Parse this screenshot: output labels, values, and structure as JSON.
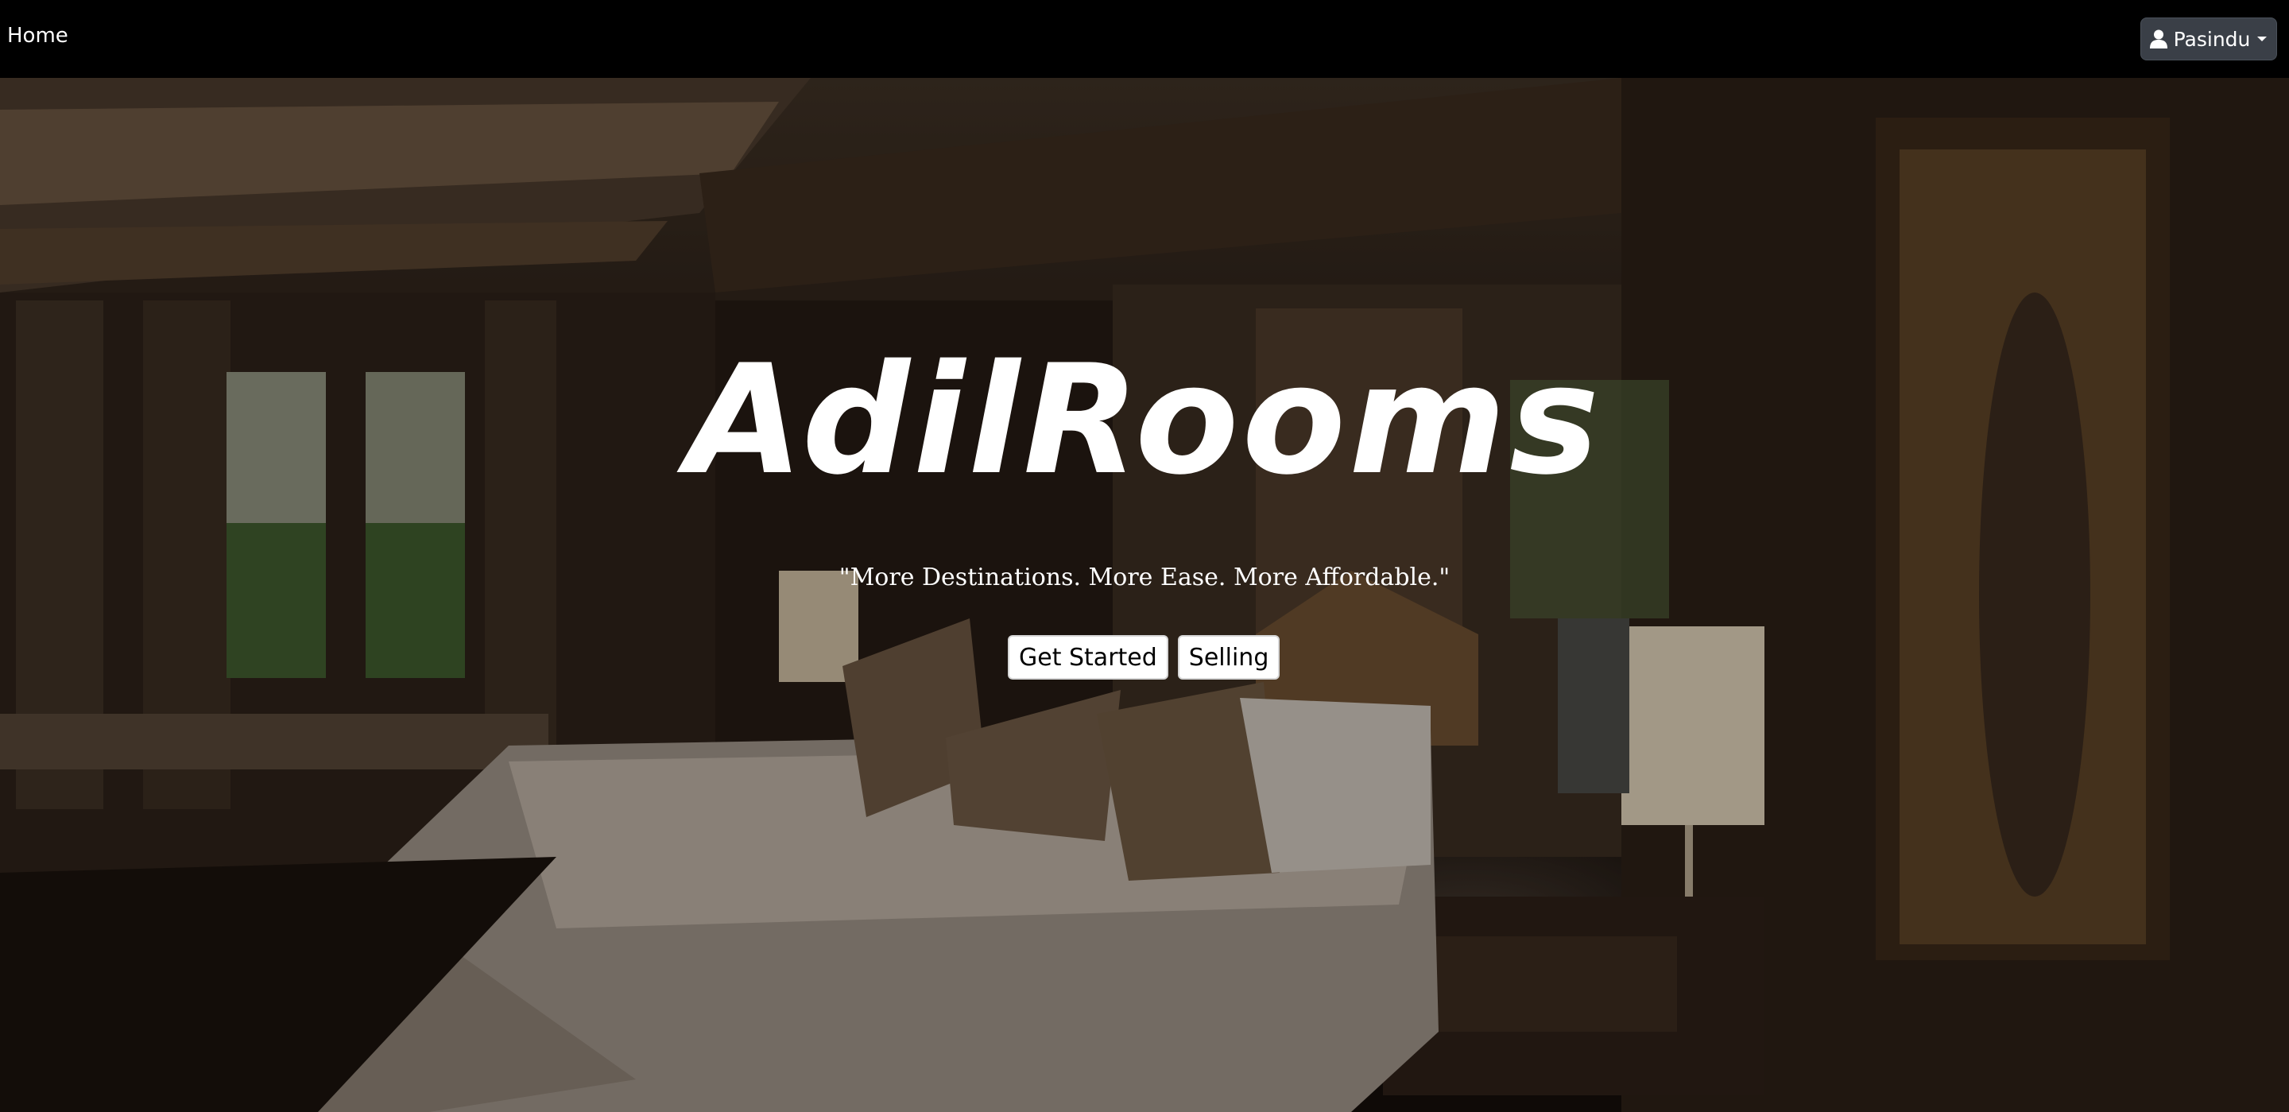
{
  "navbar": {
    "home_label": "Home",
    "user_name": "Pasindu"
  },
  "hero": {
    "title": "AdilRooms",
    "tagline": "\"More Destinations. More Ease. More Affordable.\"",
    "get_started_label": "Get Started",
    "selling_label": "Selling"
  },
  "icons": {
    "user": "person-icon",
    "dropdown": "caret-down-icon"
  },
  "colors": {
    "navbar_bg": "#000000",
    "user_button_bg": "#3a3f47",
    "text": "#ffffff"
  }
}
